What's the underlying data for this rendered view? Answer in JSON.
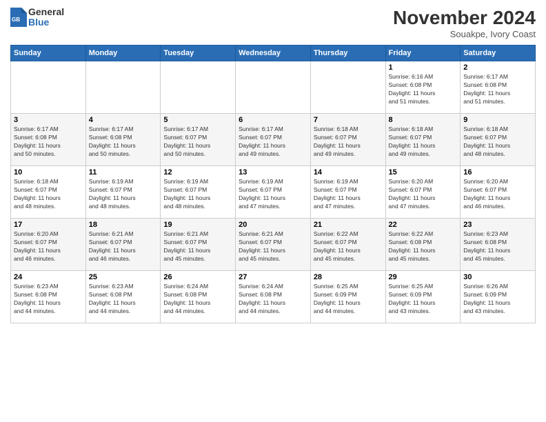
{
  "logo": {
    "general": "General",
    "blue": "Blue"
  },
  "title": "November 2024",
  "location": "Souakpe, Ivory Coast",
  "weekdays": [
    "Sunday",
    "Monday",
    "Tuesday",
    "Wednesday",
    "Thursday",
    "Friday",
    "Saturday"
  ],
  "weeks": [
    [
      {
        "day": "",
        "info": ""
      },
      {
        "day": "",
        "info": ""
      },
      {
        "day": "",
        "info": ""
      },
      {
        "day": "",
        "info": ""
      },
      {
        "day": "",
        "info": ""
      },
      {
        "day": "1",
        "info": "Sunrise: 6:16 AM\nSunset: 6:08 PM\nDaylight: 11 hours\nand 51 minutes."
      },
      {
        "day": "2",
        "info": "Sunrise: 6:17 AM\nSunset: 6:08 PM\nDaylight: 11 hours\nand 51 minutes."
      }
    ],
    [
      {
        "day": "3",
        "info": "Sunrise: 6:17 AM\nSunset: 6:08 PM\nDaylight: 11 hours\nand 50 minutes."
      },
      {
        "day": "4",
        "info": "Sunrise: 6:17 AM\nSunset: 6:08 PM\nDaylight: 11 hours\nand 50 minutes."
      },
      {
        "day": "5",
        "info": "Sunrise: 6:17 AM\nSunset: 6:07 PM\nDaylight: 11 hours\nand 50 minutes."
      },
      {
        "day": "6",
        "info": "Sunrise: 6:17 AM\nSunset: 6:07 PM\nDaylight: 11 hours\nand 49 minutes."
      },
      {
        "day": "7",
        "info": "Sunrise: 6:18 AM\nSunset: 6:07 PM\nDaylight: 11 hours\nand 49 minutes."
      },
      {
        "day": "8",
        "info": "Sunrise: 6:18 AM\nSunset: 6:07 PM\nDaylight: 11 hours\nand 49 minutes."
      },
      {
        "day": "9",
        "info": "Sunrise: 6:18 AM\nSunset: 6:07 PM\nDaylight: 11 hours\nand 48 minutes."
      }
    ],
    [
      {
        "day": "10",
        "info": "Sunrise: 6:18 AM\nSunset: 6:07 PM\nDaylight: 11 hours\nand 48 minutes."
      },
      {
        "day": "11",
        "info": "Sunrise: 6:19 AM\nSunset: 6:07 PM\nDaylight: 11 hours\nand 48 minutes."
      },
      {
        "day": "12",
        "info": "Sunrise: 6:19 AM\nSunset: 6:07 PM\nDaylight: 11 hours\nand 48 minutes."
      },
      {
        "day": "13",
        "info": "Sunrise: 6:19 AM\nSunset: 6:07 PM\nDaylight: 11 hours\nand 47 minutes."
      },
      {
        "day": "14",
        "info": "Sunrise: 6:19 AM\nSunset: 6:07 PM\nDaylight: 11 hours\nand 47 minutes."
      },
      {
        "day": "15",
        "info": "Sunrise: 6:20 AM\nSunset: 6:07 PM\nDaylight: 11 hours\nand 47 minutes."
      },
      {
        "day": "16",
        "info": "Sunrise: 6:20 AM\nSunset: 6:07 PM\nDaylight: 11 hours\nand 46 minutes."
      }
    ],
    [
      {
        "day": "17",
        "info": "Sunrise: 6:20 AM\nSunset: 6:07 PM\nDaylight: 11 hours\nand 46 minutes."
      },
      {
        "day": "18",
        "info": "Sunrise: 6:21 AM\nSunset: 6:07 PM\nDaylight: 11 hours\nand 46 minutes."
      },
      {
        "day": "19",
        "info": "Sunrise: 6:21 AM\nSunset: 6:07 PM\nDaylight: 11 hours\nand 45 minutes."
      },
      {
        "day": "20",
        "info": "Sunrise: 6:21 AM\nSunset: 6:07 PM\nDaylight: 11 hours\nand 45 minutes."
      },
      {
        "day": "21",
        "info": "Sunrise: 6:22 AM\nSunset: 6:07 PM\nDaylight: 11 hours\nand 45 minutes."
      },
      {
        "day": "22",
        "info": "Sunrise: 6:22 AM\nSunset: 6:08 PM\nDaylight: 11 hours\nand 45 minutes."
      },
      {
        "day": "23",
        "info": "Sunrise: 6:23 AM\nSunset: 6:08 PM\nDaylight: 11 hours\nand 45 minutes."
      }
    ],
    [
      {
        "day": "24",
        "info": "Sunrise: 6:23 AM\nSunset: 6:08 PM\nDaylight: 11 hours\nand 44 minutes."
      },
      {
        "day": "25",
        "info": "Sunrise: 6:23 AM\nSunset: 6:08 PM\nDaylight: 11 hours\nand 44 minutes."
      },
      {
        "day": "26",
        "info": "Sunrise: 6:24 AM\nSunset: 6:08 PM\nDaylight: 11 hours\nand 44 minutes."
      },
      {
        "day": "27",
        "info": "Sunrise: 6:24 AM\nSunset: 6:08 PM\nDaylight: 11 hours\nand 44 minutes."
      },
      {
        "day": "28",
        "info": "Sunrise: 6:25 AM\nSunset: 6:09 PM\nDaylight: 11 hours\nand 44 minutes."
      },
      {
        "day": "29",
        "info": "Sunrise: 6:25 AM\nSunset: 6:09 PM\nDaylight: 11 hours\nand 43 minutes."
      },
      {
        "day": "30",
        "info": "Sunrise: 6:26 AM\nSunset: 6:09 PM\nDaylight: 11 hours\nand 43 minutes."
      }
    ]
  ]
}
